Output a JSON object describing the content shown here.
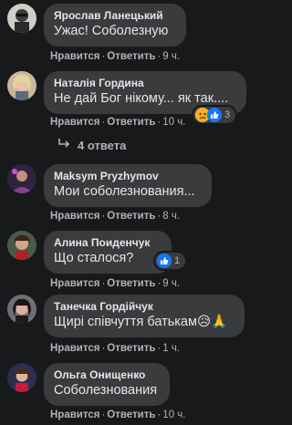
{
  "comments": [
    {
      "author": "Ярослав Ланецький",
      "text": "Ужас! Соболезную",
      "like": "Нравится",
      "reply": "Ответить",
      "time": "9 ч."
    },
    {
      "author": "Наталія Гордина",
      "text": "Не дай Бог нікому... як так....",
      "like": "Нравится",
      "reply": "Ответить",
      "time": "10 ч.",
      "reaction_count": "3",
      "reaction_icons": [
        "sad-emoji-icon",
        "like-icon"
      ]
    },
    {
      "author": "Maksym Pryzhymov",
      "text": "Мои соболезнования...",
      "like": "Нравится",
      "reply": "Ответить",
      "time": "8 ч."
    },
    {
      "author": "Алина Поиденчук",
      "text": "Що сталося?",
      "like": "Нравится",
      "reply": "Ответить",
      "time": "9 ч.",
      "reaction_count": "1",
      "reaction_icons": [
        "like-icon"
      ]
    },
    {
      "author": "Танечка Гордійчук",
      "text": "Щирі співчуття батькам😥🙏",
      "like": "Нравится",
      "reply": "Ответить",
      "time": "1 ч."
    },
    {
      "author": "Ольга Онищенко",
      "text": "Соболезнования",
      "like": "Нравится",
      "reply": "Ответить",
      "time": "10 ч."
    }
  ],
  "replies_link": "4 ответа",
  "colors": {
    "background": "#18191a",
    "bubble": "#3a3b3c",
    "muted_text": "#b0b3b8",
    "like_blue": "#1877f2",
    "sad_yellow": "#f7b125"
  }
}
